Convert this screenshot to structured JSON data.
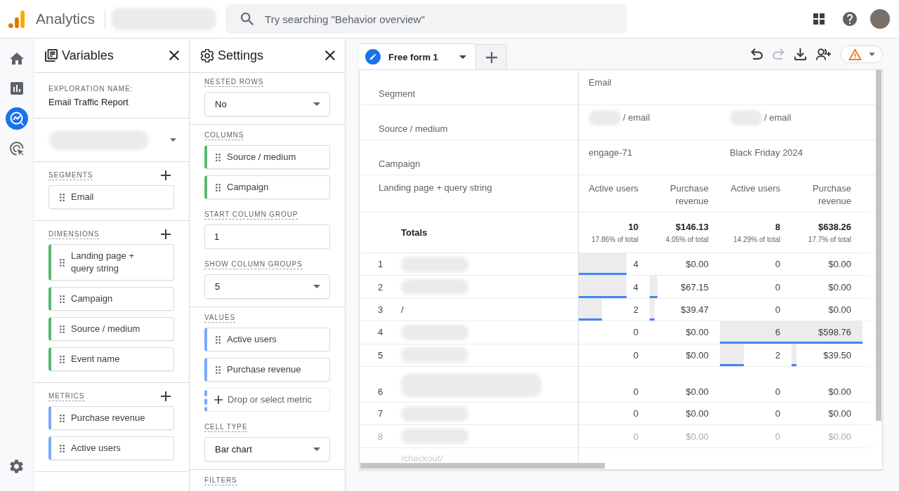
{
  "app": {
    "name": "Analytics",
    "search_placeholder": "Try searching \"Behavior overview\""
  },
  "nav_rail": {
    "items": [
      {
        "kind": "home",
        "selected": false
      },
      {
        "kind": "reports",
        "selected": false
      },
      {
        "kind": "explore",
        "selected": true
      },
      {
        "kind": "advertising",
        "selected": false
      }
    ]
  },
  "variables": {
    "title": "Variables",
    "exploration_label": "EXPLORATION NAME:",
    "exploration_name": "Email Traffic Report",
    "sections": [
      {
        "label": "SEGMENTS",
        "kind": "segment",
        "items": [
          "Email"
        ]
      },
      {
        "label": "DIMENSIONS",
        "kind": "dimension",
        "items": [
          "Landing page + query string",
          "Campaign",
          "Source / medium",
          "Event name"
        ]
      },
      {
        "label": "METRICS",
        "kind": "metric",
        "items": [
          "Purchase revenue",
          "Active users"
        ]
      }
    ]
  },
  "settings": {
    "title": "Settings",
    "groups": [
      {
        "fields": [
          {
            "label": "NESTED ROWS",
            "kind": "select",
            "value": "No"
          }
        ]
      },
      {
        "fields": [
          {
            "label": "COLUMNS",
            "kind": "chips",
            "items": [
              {
                "kind": "dimension",
                "text": "Source / medium"
              },
              {
                "kind": "dimension",
                "text": "Campaign"
              }
            ]
          },
          {
            "label": "START COLUMN GROUP",
            "kind": "input",
            "value": "1"
          },
          {
            "label": "SHOW COLUMN GROUPS",
            "kind": "select",
            "value": "5"
          }
        ]
      },
      {
        "fields": [
          {
            "label": "VALUES",
            "kind": "chips",
            "items": [
              {
                "kind": "metric",
                "text": "Active users"
              },
              {
                "kind": "metric",
                "text": "Purchase revenue"
              },
              {
                "kind": "drop",
                "text": "Drop or select metric"
              }
            ]
          },
          {
            "label": "CELL TYPE",
            "kind": "select",
            "value": "Bar chart"
          }
        ]
      },
      {
        "fields": [
          {
            "label": "FILTERS",
            "kind": "heading"
          }
        ]
      }
    ]
  },
  "tabs": [
    {
      "label": "Free form 1",
      "selected": true
    }
  ],
  "toolbar": [
    {
      "kind": "undo",
      "disabled": false
    },
    {
      "kind": "redo",
      "disabled": true
    },
    {
      "kind": "download",
      "disabled": false
    },
    {
      "kind": "share",
      "disabled": false
    },
    {
      "kind": "warning",
      "disabled": false
    }
  ],
  "table": {
    "header_rows": [
      {
        "label": "Segment",
        "cells": [
          {
            "text": "Email",
            "redacted_prefix": false
          }
        ]
      },
      {
        "label": "Source / medium",
        "cells": [
          {
            "text": "/ email",
            "redacted_prefix": true
          },
          {
            "text": "/ email",
            "redacted_prefix": true
          }
        ]
      },
      {
        "label": "Campaign",
        "cells": [
          {
            "text": "engage-71",
            "redacted_prefix": false
          },
          {
            "text": "Black Friday 2024",
            "redacted_prefix": false
          }
        ]
      }
    ],
    "dimension_label": "Landing page + query string",
    "columns": [
      "Active users",
      "Purchase revenue",
      "Active users",
      "Purchase revenue"
    ],
    "totals": {
      "label": "Totals",
      "cells": [
        {
          "value": "10",
          "share": "17.86% of total"
        },
        {
          "value": "$146.13",
          "share": "4.05% of total"
        },
        {
          "value": "8",
          "share": "14.29% of total"
        },
        {
          "value": "$638.26",
          "share": "17.7% of total"
        }
      ]
    },
    "rows": [
      {
        "index": "1",
        "kind": "redacted",
        "faded": false,
        "cells": [
          {
            "text": "4",
            "level": 0.67
          },
          {
            "text": "$0.00"
          },
          {
            "text": "0"
          },
          {
            "text": "$0.00"
          }
        ]
      },
      {
        "index": "2",
        "kind": "redacted",
        "faded": false,
        "cells": [
          {
            "text": "4",
            "level": 0.67
          },
          {
            "text": "$67.15",
            "level": 0.11
          },
          {
            "text": "0"
          },
          {
            "text": "$0.00"
          }
        ]
      },
      {
        "index": "3",
        "kind": "text",
        "label": "/",
        "faded": false,
        "cells": [
          {
            "text": "2",
            "level": 0.33
          },
          {
            "text": "$39.47",
            "level": 0.07
          },
          {
            "text": "0"
          },
          {
            "text": "$0.00"
          }
        ]
      },
      {
        "index": "4",
        "kind": "redacted",
        "faded": false,
        "cells": [
          {
            "text": "0"
          },
          {
            "text": "$0.00"
          },
          {
            "text": "6",
            "level": 1
          },
          {
            "text": "$598.76",
            "level": 1
          }
        ]
      },
      {
        "index": "5",
        "kind": "redacted",
        "faded": false,
        "cells": [
          {
            "text": "0"
          },
          {
            "text": "$0.00"
          },
          {
            "text": "2",
            "level": 0.33
          },
          {
            "text": "$39.50",
            "level": 0.07
          }
        ]
      },
      {
        "index": "6",
        "kind": "redacted_wrapped",
        "faded": false,
        "cells": [
          {
            "text": "0"
          },
          {
            "text": "$0.00"
          },
          {
            "text": "0"
          },
          {
            "text": "$0.00"
          }
        ]
      },
      {
        "index": "7",
        "kind": "redacted",
        "faded": false,
        "cells": [
          {
            "text": "0"
          },
          {
            "text": "$0.00"
          },
          {
            "text": "0"
          },
          {
            "text": "$0.00"
          }
        ]
      },
      {
        "index": "8",
        "kind": "redacted",
        "faded": true,
        "cells": [
          {
            "text": "0"
          },
          {
            "text": "$0.00"
          },
          {
            "text": "0"
          },
          {
            "text": "$0.00"
          }
        ]
      },
      {
        "kind": "text",
        "label": "/checkout/",
        "faded": true
      }
    ]
  }
}
